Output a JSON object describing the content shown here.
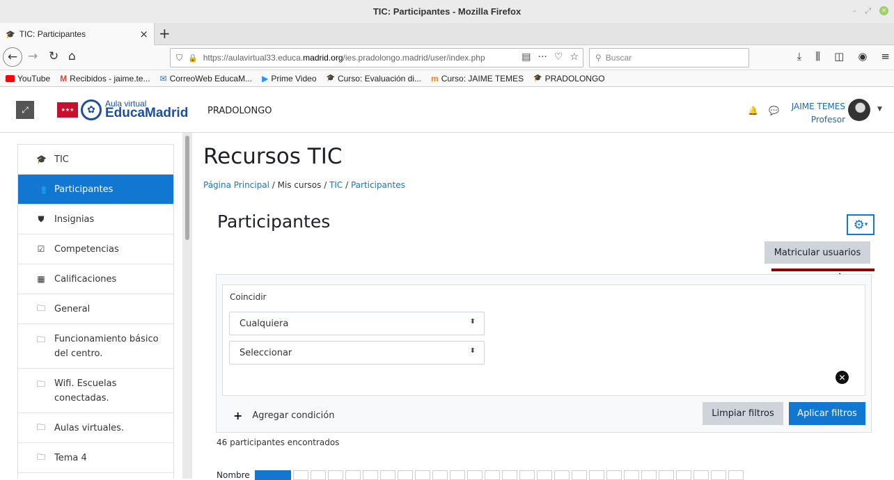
{
  "window": {
    "title": "TIC: Participantes - Mozilla Firefox"
  },
  "tab": {
    "label": "TIC: Participantes"
  },
  "urlbar": {
    "url_pre": "https://aulavirtual33.educa.",
    "url_domain": "madrid.org",
    "url_post": "/ies.pradolongo.madrid/user/index.php",
    "search_placeholder": "Buscar"
  },
  "bookmarks": [
    {
      "label": "YouTube",
      "color": "#ff0000"
    },
    {
      "label": "Recibidos - jaime.te...",
      "color": "#db4437"
    },
    {
      "label": "CorreoWeb EducaM...",
      "color": "#1a73e8"
    },
    {
      "label": "Prime Video",
      "color": "#1a98ff"
    },
    {
      "label": "Curso: Evaluación di...",
      "color": "#1c4fa0"
    },
    {
      "label": "Curso: JAIME TEMES",
      "color": "#f98012"
    },
    {
      "label": "PRADOLONGO",
      "color": "#1c4fa0"
    }
  ],
  "header": {
    "logo_sub": "Aula virtual",
    "logo_main": "EducaMadrid",
    "site_name": "PRADOLONGO",
    "user_name": "JAIME TEMES",
    "user_role": "Profesor"
  },
  "sidebar": {
    "items": [
      {
        "label": "TIC",
        "icon": "graduation-cap-icon",
        "glyph": "🎓"
      },
      {
        "label": "Participantes",
        "icon": "users-icon",
        "glyph": "👥"
      },
      {
        "label": "Insignias",
        "icon": "shield-icon",
        "glyph": "⛊"
      },
      {
        "label": "Competencias",
        "icon": "checkbox-icon",
        "glyph": "☑"
      },
      {
        "label": "Calificaciones",
        "icon": "table-icon",
        "glyph": "▦"
      },
      {
        "label": "General",
        "icon": "folder-icon",
        "glyph": "🗀"
      },
      {
        "label": "Funcionamiento básico del centro.",
        "icon": "folder-icon",
        "glyph": "🗀"
      },
      {
        "label": "Wifi. Escuelas conectadas.",
        "icon": "folder-icon",
        "glyph": "🗀"
      },
      {
        "label": "Aulas virtuales.",
        "icon": "folder-icon",
        "glyph": "🗀"
      },
      {
        "label": "Tema 4",
        "icon": "folder-icon",
        "glyph": "🗀"
      }
    ]
  },
  "main": {
    "course_title": "Recursos TIC",
    "breadcrumb": [
      "Página Principal",
      "Mis cursos",
      "TIC",
      "Participantes"
    ],
    "page_heading": "Participantes",
    "enrol_button": "Matricular usuarios",
    "filters": {
      "match_label": "Coincidir",
      "match_value": "Cualquiera",
      "select_value": "Seleccionar",
      "add_condition": "Agregar condición",
      "clear_button": "Limpiar filtros",
      "apply_button": "Aplicar filtros"
    },
    "count_text": "46 participantes encontrados",
    "initials_label": "Nombre"
  },
  "colors": {
    "accent": "#1177d1",
    "annotation": "#8b0000"
  }
}
